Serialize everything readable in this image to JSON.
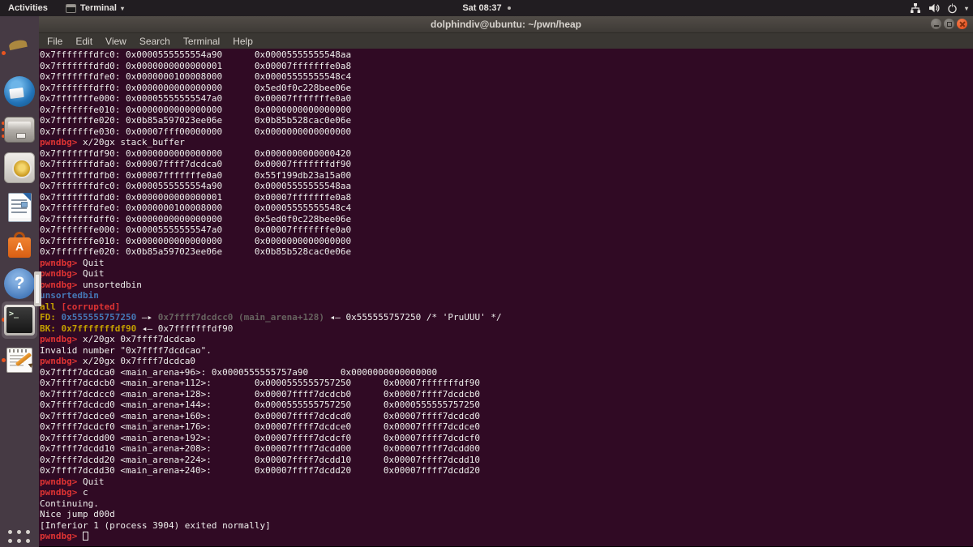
{
  "top_bar": {
    "activities_label": "Activities",
    "app_menu_label": "Terminal",
    "clock": "Sat 08:37",
    "tray_icons": [
      "network-icon",
      "volume-icon",
      "power-icon",
      "caret-down-icon"
    ],
    "caret": "▾"
  },
  "window": {
    "title": "dolphindiv@ubuntu: ~/pwn/heap",
    "menus": [
      "File",
      "Edit",
      "View",
      "Search",
      "Terminal",
      "Help"
    ],
    "controls": [
      "minimize",
      "maximize",
      "close"
    ]
  },
  "dock": {
    "apps": [
      "firefox",
      "thunderbird",
      "files",
      "rhythmbox",
      "libreoffice-writer",
      "ubuntu-software",
      "help",
      "terminal",
      "text-editor",
      "show-applications"
    ],
    "running_indicator_color": "#e95420",
    "active_app": "terminal",
    "terminal_icon_glyph": ">_"
  },
  "terminal": {
    "colors": {
      "bg": "#300a24",
      "fg": "#eeeeec",
      "red": "#dd3333",
      "blue": "#4577b5",
      "yellow": "#c4a000",
      "dim": "#66625e",
      "accent": "#e95420"
    },
    "lines": [
      [
        [
          "w",
          "0x7fffffffdfc0: 0x0000555555554a90      0x00005555555548aa"
        ]
      ],
      [
        [
          "w",
          "0x7fffffffdfd0: 0x0000000000000001      0x00007fffffffe0a8"
        ]
      ],
      [
        [
          "w",
          "0x7fffffffdfe0: 0x0000000100008000      0x00005555555548c4"
        ]
      ],
      [
        [
          "w",
          "0x7fffffffdff0: 0x0000000000000000      0x5ed0f0c228bee06e"
        ]
      ],
      [
        [
          "w",
          "0x7fffffffe000: 0x00005555555547a0      0x00007fffffffe0a0"
        ]
      ],
      [
        [
          "w",
          "0x7fffffffe010: 0x0000000000000000      0x0000000000000000"
        ]
      ],
      [
        [
          "w",
          "0x7fffffffe020: 0x0b85a597023ee06e      0x0b85b528cac0e06e"
        ]
      ],
      [
        [
          "w",
          "0x7fffffffe030: 0x00007fff00000000      0x0000000000000000"
        ]
      ],
      [
        [
          "r",
          "pwndbg> "
        ],
        [
          "w",
          "x/20gx stack_buffer"
        ]
      ],
      [
        [
          "w",
          "0x7fffffffdf90: 0x0000000000000000      0x0000000000000420"
        ]
      ],
      [
        [
          "w",
          "0x7fffffffdfa0: 0x00007ffff7dcdca0      0x00007fffffffdf90"
        ]
      ],
      [
        [
          "w",
          "0x7fffffffdfb0: 0x00007fffffffe0a0      0x55f199db23a15a00"
        ]
      ],
      [
        [
          "w",
          "0x7fffffffdfc0: 0x0000555555554a90      0x00005555555548aa"
        ]
      ],
      [
        [
          "w",
          "0x7fffffffdfd0: 0x0000000000000001      0x00007fffffffe0a8"
        ]
      ],
      [
        [
          "w",
          "0x7fffffffdfe0: 0x0000000100008000      0x00005555555548c4"
        ]
      ],
      [
        [
          "w",
          "0x7fffffffdff0: 0x0000000000000000      0x5ed0f0c228bee06e"
        ]
      ],
      [
        [
          "w",
          "0x7fffffffe000: 0x00005555555547a0      0x00007fffffffe0a0"
        ]
      ],
      [
        [
          "w",
          "0x7fffffffe010: 0x0000000000000000      0x0000000000000000"
        ]
      ],
      [
        [
          "w",
          "0x7fffffffe020: 0x0b85a597023ee06e      0x0b85b528cac0e06e"
        ]
      ],
      [
        [
          "r",
          "pwndbg> "
        ],
        [
          "w",
          "Quit"
        ]
      ],
      [
        [
          "r",
          "pwndbg> "
        ],
        [
          "w",
          "Quit"
        ]
      ],
      [
        [
          "r",
          "pwndbg> "
        ],
        [
          "w",
          "unsortedbin"
        ]
      ],
      [
        [
          "b",
          "unsortedbin"
        ]
      ],
      [
        [
          "y",
          "all"
        ],
        [
          "w",
          " "
        ],
        [
          "r",
          "[corrupted]"
        ]
      ],
      [
        [
          "y",
          "FD: "
        ],
        [
          "b",
          "0x555555757250"
        ],
        [
          "w",
          " —▸ "
        ],
        [
          "d",
          "0x7ffff7dcdcc0 (main_arena+128)"
        ],
        [
          "w",
          " ◂— 0x555555757250 /* 'PruUUU' */"
        ]
      ],
      [
        [
          "y",
          "BK: 0x7fffffffdf90"
        ],
        [
          "w",
          " ◂— 0x7fffffffdf90"
        ]
      ],
      [
        [
          "r",
          "pwndbg> "
        ],
        [
          "w",
          "x/20gx 0x7ffff7dcdcao"
        ]
      ],
      [
        [
          "w",
          "Invalid number \"0x7ffff7dcdcao\"."
        ]
      ],
      [
        [
          "r",
          "pwndbg> "
        ],
        [
          "w",
          "x/20gx 0x7ffff7dcdca0"
        ]
      ],
      [
        [
          "w",
          "0x7ffff7dcdca0 <main_arena+96>: 0x0000555555757a90      0x0000000000000000"
        ]
      ],
      [
        [
          "w",
          "0x7ffff7dcdcb0 <main_arena+112>:        0x0000555555757250      0x00007fffffffdf90"
        ]
      ],
      [
        [
          "w",
          "0x7ffff7dcdcc0 <main_arena+128>:        0x00007ffff7dcdcb0      0x00007ffff7dcdcb0"
        ]
      ],
      [
        [
          "w",
          "0x7ffff7dcdcd0 <main_arena+144>:        0x0000555555757250      0x0000555555757250"
        ]
      ],
      [
        [
          "w",
          "0x7ffff7dcdce0 <main_arena+160>:        0x00007ffff7dcdcd0      0x00007ffff7dcdcd0"
        ]
      ],
      [
        [
          "w",
          "0x7ffff7dcdcf0 <main_arena+176>:        0x00007ffff7dcdce0      0x00007ffff7dcdce0"
        ]
      ],
      [
        [
          "w",
          "0x7ffff7dcdd00 <main_arena+192>:        0x00007ffff7dcdcf0      0x00007ffff7dcdcf0"
        ]
      ],
      [
        [
          "w",
          "0x7ffff7dcdd10 <main_arena+208>:        0x00007ffff7dcdd00      0x00007ffff7dcdd00"
        ]
      ],
      [
        [
          "w",
          "0x7ffff7dcdd20 <main_arena+224>:        0x00007ffff7dcdd10      0x00007ffff7dcdd10"
        ]
      ],
      [
        [
          "w",
          "0x7ffff7dcdd30 <main_arena+240>:        0x00007ffff7dcdd20      0x00007ffff7dcdd20"
        ]
      ],
      [
        [
          "r",
          "pwndbg> "
        ],
        [
          "w",
          "Quit"
        ]
      ],
      [
        [
          "r",
          "pwndbg> "
        ],
        [
          "w",
          "c"
        ]
      ],
      [
        [
          "w",
          "Continuing."
        ]
      ],
      [
        [
          "w",
          "Nice jump d00d"
        ]
      ],
      [
        [
          "w",
          "[Inferior 1 (process 3904) exited normally]"
        ]
      ],
      [
        [
          "r",
          "pwndbg> "
        ],
        [
          "cursor",
          ""
        ]
      ]
    ]
  }
}
